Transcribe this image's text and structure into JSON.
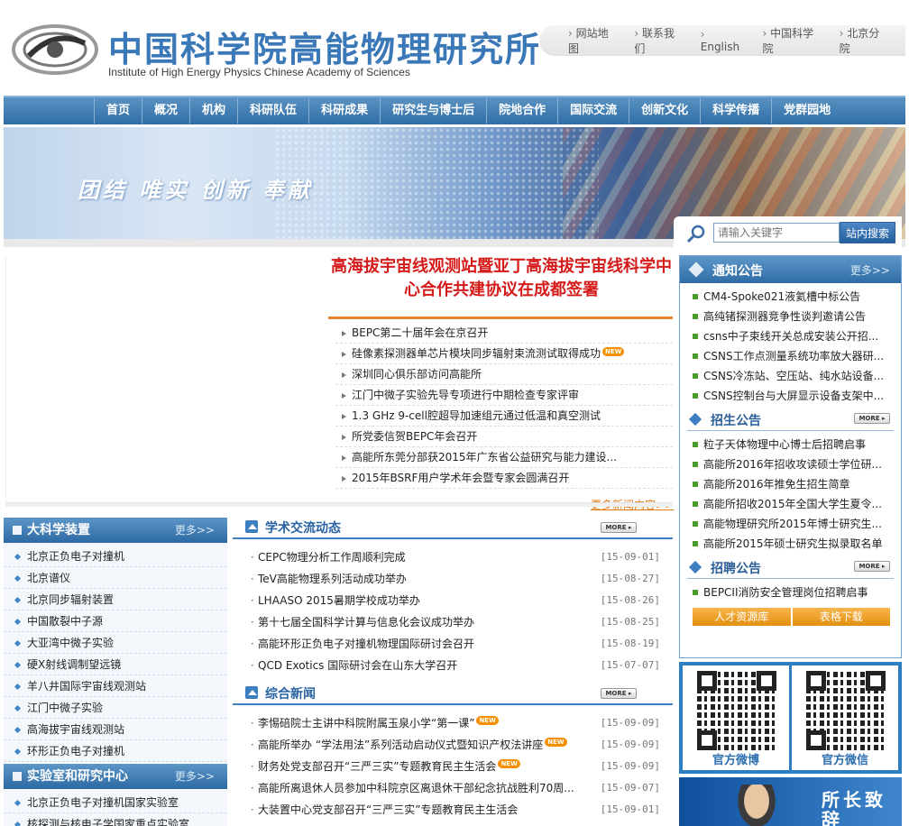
{
  "header": {
    "logo_cn": "中国科学院高能物理研究所",
    "logo_en": "Institute of High Energy Physics Chinese Academy of Sciences",
    "toplinks": [
      "网站地图",
      "联系我们",
      "English",
      "中国科学院",
      "北京分院"
    ]
  },
  "nav": [
    "首页",
    "概况",
    "机构",
    "科研队伍",
    "科研成果",
    "研究生与博士后",
    "院地合作",
    "国际交流",
    "创新文化",
    "科学传播",
    "党群园地"
  ],
  "banner": {
    "slogan": "团结 唯实 创新 奉献"
  },
  "search": {
    "placeholder": "请输入关键字",
    "button": "站内搜索"
  },
  "headline": "高海拔宇宙线观测站暨亚丁高海拔宇宙线科学中心合作共建协议在成都签署",
  "news": [
    {
      "text": "BEPC第二十届年会在京召开",
      "new": false
    },
    {
      "text": "硅像素探测器单芯片模块同步辐射束流测试取得成功",
      "new": true
    },
    {
      "text": "深圳同心俱乐部访问高能所",
      "new": false
    },
    {
      "text": "江门中微子实验先导专项进行中期检查专家评审",
      "new": false
    },
    {
      "text": "1.3 GHz 9-cell腔超导加速组元通过低温和真空测试",
      "new": false
    },
    {
      "text": "所党委信贺BEPC年会召开",
      "new": false
    },
    {
      "text": "高能所东莞分部获2015年广东省公益研究与能力建设...",
      "new": false
    },
    {
      "text": "2015年BSRF用户学术年会暨专家会圆满召开",
      "new": false
    }
  ],
  "more_news": "更多新闻内容>>",
  "new_badge": "NEW",
  "more_label": "更多>>",
  "more_btn": "MORE ▸",
  "left_boxes": [
    {
      "title": "大科学装置",
      "items": [
        "北京正负电子对撞机",
        "北京谱仪",
        "北京同步辐射装置",
        "中国散裂中子源",
        "大亚湾中微子实验",
        "硬X射线调制望远镜",
        "羊八井国际宇宙线观测站",
        "江门中微子实验",
        "高海拔宇宙线观测站",
        "环形正负电子对撞机"
      ]
    },
    {
      "title": "实验室和研究中心",
      "items": [
        "北京正负电子对撞机国家实验室",
        "核探测与核电子学国家重点实验室"
      ]
    }
  ],
  "academic": {
    "title": "学术交流动态",
    "items": [
      {
        "text": "CEPC物理分析工作周顺利完成",
        "date": "[15-09-01]"
      },
      {
        "text": "TeV高能物理系列活动成功举办",
        "date": "[15-08-27]"
      },
      {
        "text": "LHAASO 2015暑期学校成功举办",
        "date": "[15-08-26]"
      },
      {
        "text": "第十七届全国科学计算与信息化会议成功举办",
        "date": "[15-08-25]"
      },
      {
        "text": "高能环形正负电子对撞机物理国际研讨会召开",
        "date": "[15-08-19]"
      },
      {
        "text": "QCD Exotics 国际研讨会在山东大学召开",
        "date": "[15-07-07]"
      }
    ]
  },
  "general": {
    "title": "综合新闻",
    "items": [
      {
        "text": "李惕碚院士主讲中科院附属玉泉小学“第一课”",
        "date": "[15-09-09]",
        "new": true
      },
      {
        "text": "高能所举办 “学法用法”系列活动启动仪式暨知识产权法讲座",
        "date": "[15-09-09]",
        "new": true
      },
      {
        "text": "财务处党支部召开“三严三实”专题教育民主生活会",
        "date": "[15-09-09]",
        "new": true
      },
      {
        "text": "高能所离退休人员参加中科院京区离退休干部纪念抗战胜利70周...",
        "date": "[15-09-07]",
        "new": false
      },
      {
        "text": "大装置中心党支部召开“三严三实”专题教育民主生活会",
        "date": "[15-09-01]",
        "new": false
      }
    ]
  },
  "notice": {
    "title": "通知公告",
    "items": [
      "CM4-Spoke021液氦槽中标公告",
      "高纯锗探测器竞争性谈判邀请公告",
      "csns中子束线开关总成安装公开招...",
      "CSNS工作点测量系统功率放大器研...",
      "CSNS冷冻站、空压站、纯水站设备...",
      "CSNS控制台与大屏显示设备支架中..."
    ]
  },
  "admission": {
    "title": "招生公告",
    "items": [
      "粒子天体物理中心博士后招聘启事",
      "高能所2016年招收攻读硕士学位研...",
      "高能所2016年推免生招生简章",
      "高能所招收2015年全国大学生夏令...",
      "高能物理研究所2015年博士研究生...",
      "高能所2015年硕士研究生拟录取名单"
    ]
  },
  "recruit": {
    "title": "招聘公告",
    "items": [
      "BEPCII消防安全管理岗位招聘启事"
    ],
    "buttons": [
      "人才资源库",
      "表格下载"
    ]
  },
  "qr": [
    "官方微博",
    "官方微信"
  ],
  "director_tag": "所长致辞",
  "colors": {
    "nav": "#2f6da6",
    "headline": "#d51a1a",
    "accent_orange": "#e6852b",
    "bullet_green": "#4b9a2c"
  }
}
